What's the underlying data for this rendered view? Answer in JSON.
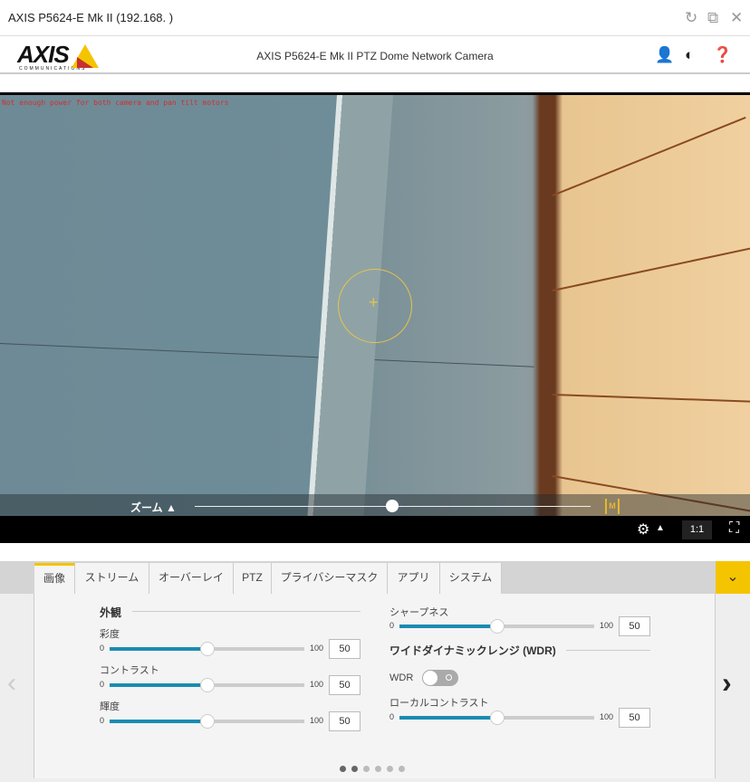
{
  "window": {
    "title": "AXIS P5624-E Mk II (192.168.        )",
    "icons": [
      "refresh-icon",
      "external-link-icon",
      "close-icon"
    ]
  },
  "header": {
    "logo": "AXIS",
    "logo_sub": "COMMUNICATIONS",
    "title": "AXIS P5624-E Mk II PTZ Dome Network Camera"
  },
  "video": {
    "overlay_text": "Not enough power for both camera and pan tilt motors",
    "zoom_label": "ズーム ▲",
    "zoom_level": 0.5,
    "manual_focus_label": "M"
  },
  "toolbar": {
    "ratio_label": "1:1",
    "up_arrow": "▲"
  },
  "tabs": [
    {
      "label": "画像",
      "active": true
    },
    {
      "label": "ストリーム"
    },
    {
      "label": "オーバーレイ"
    },
    {
      "label": "PTZ"
    },
    {
      "label": "プライバシーマスク"
    },
    {
      "label": "アプリ"
    },
    {
      "label": "システム"
    }
  ],
  "panel": {
    "appearance": {
      "heading": "外観",
      "sliders": [
        {
          "label": "彩度",
          "min": "0",
          "max": "100",
          "value": "50"
        },
        {
          "label": "コントラスト",
          "min": "0",
          "max": "100",
          "value": "50"
        },
        {
          "label": "輝度",
          "min": "0",
          "max": "100",
          "value": "50"
        }
      ]
    },
    "sharpness": {
      "label": "シャープネス",
      "min": "0",
      "max": "100",
      "value": "50"
    },
    "wdr": {
      "heading": "ワイドダイナミックレンジ (WDR)",
      "toggle_label": "WDR",
      "enabled": false,
      "local_contrast": {
        "label": "ローカルコントラスト",
        "min": "0",
        "max": "100",
        "value": "50"
      }
    },
    "pagination": {
      "pages": 6,
      "current": 2
    }
  }
}
